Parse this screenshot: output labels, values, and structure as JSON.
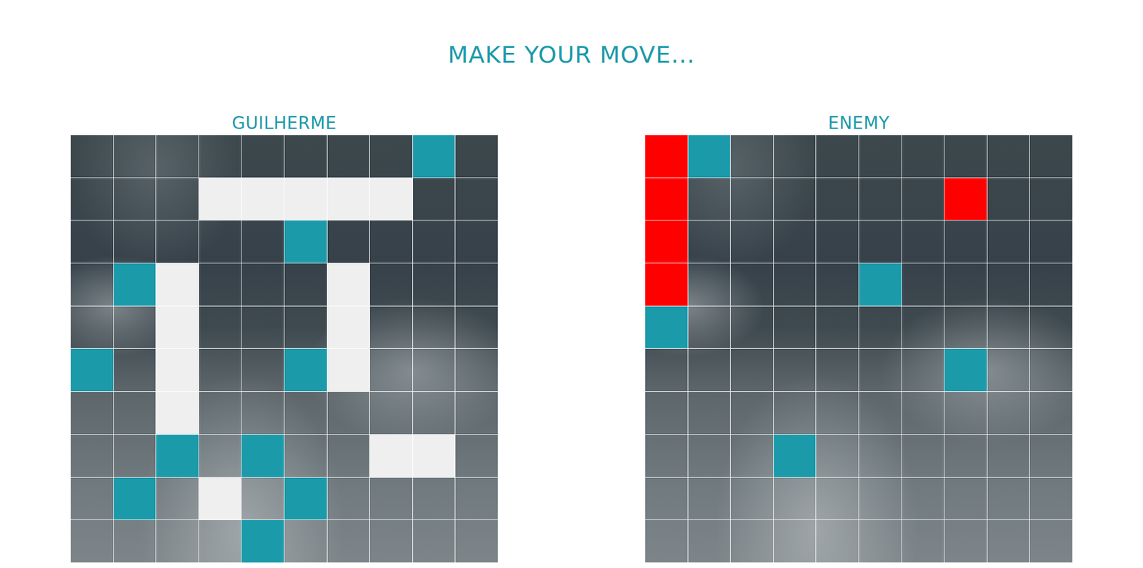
{
  "title": "MAKE YOUR MOVE...",
  "boards": [
    {
      "name": "GUILHERME",
      "rows": [
        [
          "water",
          "water",
          "water",
          "water",
          "water",
          "water",
          "water",
          "water",
          "miss",
          "water"
        ],
        [
          "water",
          "water",
          "water",
          "ship",
          "ship",
          "ship",
          "ship",
          "ship",
          "water",
          "water"
        ],
        [
          "water",
          "water",
          "water",
          "water",
          "water",
          "miss",
          "water",
          "water",
          "water",
          "water"
        ],
        [
          "water",
          "miss",
          "ship",
          "water",
          "water",
          "water",
          "ship",
          "water",
          "water",
          "water"
        ],
        [
          "water",
          "water",
          "ship",
          "water",
          "water",
          "water",
          "ship",
          "water",
          "water",
          "water"
        ],
        [
          "miss",
          "water",
          "ship",
          "water",
          "water",
          "miss",
          "ship",
          "water",
          "water",
          "water"
        ],
        [
          "water",
          "water",
          "ship",
          "water",
          "water",
          "water",
          "water",
          "water",
          "water",
          "water"
        ],
        [
          "water",
          "water",
          "miss",
          "water",
          "miss",
          "water",
          "water",
          "ship",
          "ship",
          "water"
        ],
        [
          "water",
          "miss",
          "water",
          "ship",
          "water",
          "miss",
          "water",
          "water",
          "water",
          "water"
        ],
        [
          "water",
          "water",
          "water",
          "water",
          "miss",
          "water",
          "water",
          "water",
          "water",
          "water"
        ]
      ]
    },
    {
      "name": "ENEMY",
      "rows": [
        [
          "hit",
          "miss",
          "water",
          "water",
          "water",
          "water",
          "water",
          "water",
          "water",
          "water"
        ],
        [
          "hit",
          "water",
          "water",
          "water",
          "water",
          "water",
          "water",
          "hit",
          "water",
          "water"
        ],
        [
          "hit",
          "water",
          "water",
          "water",
          "water",
          "water",
          "water",
          "water",
          "water",
          "water"
        ],
        [
          "hit",
          "water",
          "water",
          "water",
          "water",
          "miss",
          "water",
          "water",
          "water",
          "water"
        ],
        [
          "miss",
          "water",
          "water",
          "water",
          "water",
          "water",
          "water",
          "water",
          "water",
          "water"
        ],
        [
          "water",
          "water",
          "water",
          "water",
          "water",
          "water",
          "water",
          "miss",
          "water",
          "water"
        ],
        [
          "water",
          "water",
          "water",
          "water",
          "water",
          "water",
          "water",
          "water",
          "water",
          "water"
        ],
        [
          "water",
          "water",
          "water",
          "miss",
          "water",
          "water",
          "water",
          "water",
          "water",
          "water"
        ],
        [
          "water",
          "water",
          "water",
          "water",
          "water",
          "water",
          "water",
          "water",
          "water",
          "water"
        ],
        [
          "water",
          "water",
          "water",
          "water",
          "water",
          "water",
          "water",
          "water",
          "water",
          "water"
        ]
      ]
    }
  ]
}
